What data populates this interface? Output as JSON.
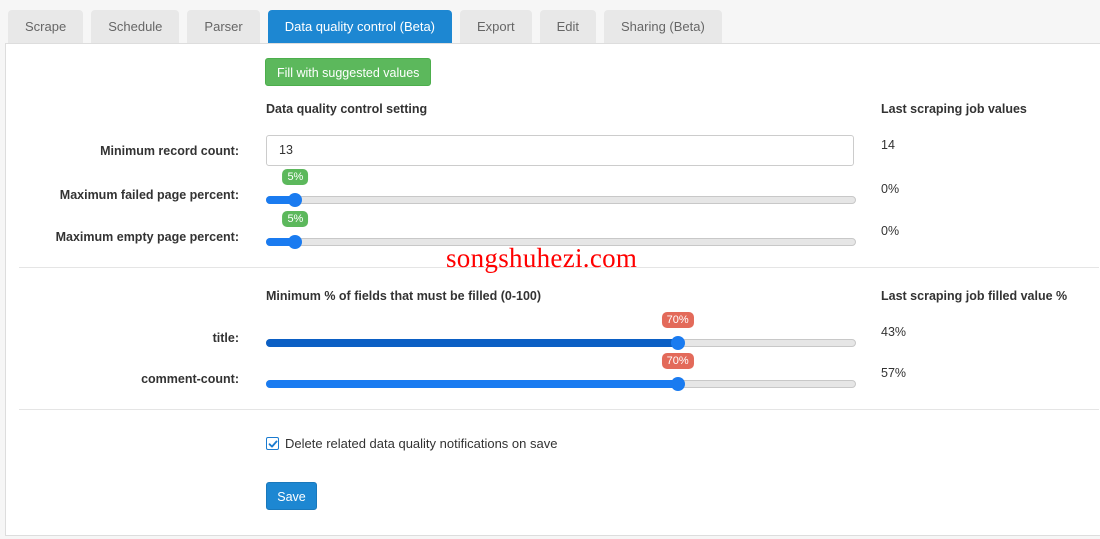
{
  "tabs": [
    {
      "label": "Scrape",
      "active": false
    },
    {
      "label": "Schedule",
      "active": false
    },
    {
      "label": "Parser",
      "active": false
    },
    {
      "label": "Data quality control (Beta)",
      "active": true
    },
    {
      "label": "Export",
      "active": false
    },
    {
      "label": "Edit",
      "active": false
    },
    {
      "label": "Sharing (Beta)",
      "active": false
    }
  ],
  "fill_button_label": "Fill with suggested values",
  "section1": {
    "setting_header": "Data quality control setting",
    "last_values_header": "Last scraping job values",
    "min_record": {
      "label": "Minimum record count:",
      "value": "13",
      "last": "14"
    },
    "max_failed": {
      "label": "Maximum failed page percent:",
      "value_percent": 5,
      "bubble": "5%",
      "last": "0%"
    },
    "max_empty": {
      "label": "Maximum empty page percent:",
      "value_percent": 5,
      "bubble": "5%",
      "last": "0%"
    }
  },
  "section2": {
    "fields_header": "Minimum % of fields that must be filled (0-100)",
    "last_filled_header": "Last scraping job filled value %",
    "fields": [
      {
        "label": "title:",
        "value_percent": 70,
        "bubble": "70%",
        "last": "43%"
      },
      {
        "label": "comment-count:",
        "value_percent": 70,
        "bubble": "70%",
        "last": "57%"
      }
    ]
  },
  "delete_notifications": {
    "label": "Delete related data quality notifications on save",
    "checked": true
  },
  "save_label": "Save",
  "watermark": "songshuhezi.com",
  "colors": {
    "accent": "#1d87d2",
    "success": "#5cb85c",
    "danger": "#e36a5a",
    "slider_blue": "#1a7bf0",
    "slider_dark_blue": "#0b5fc4"
  }
}
